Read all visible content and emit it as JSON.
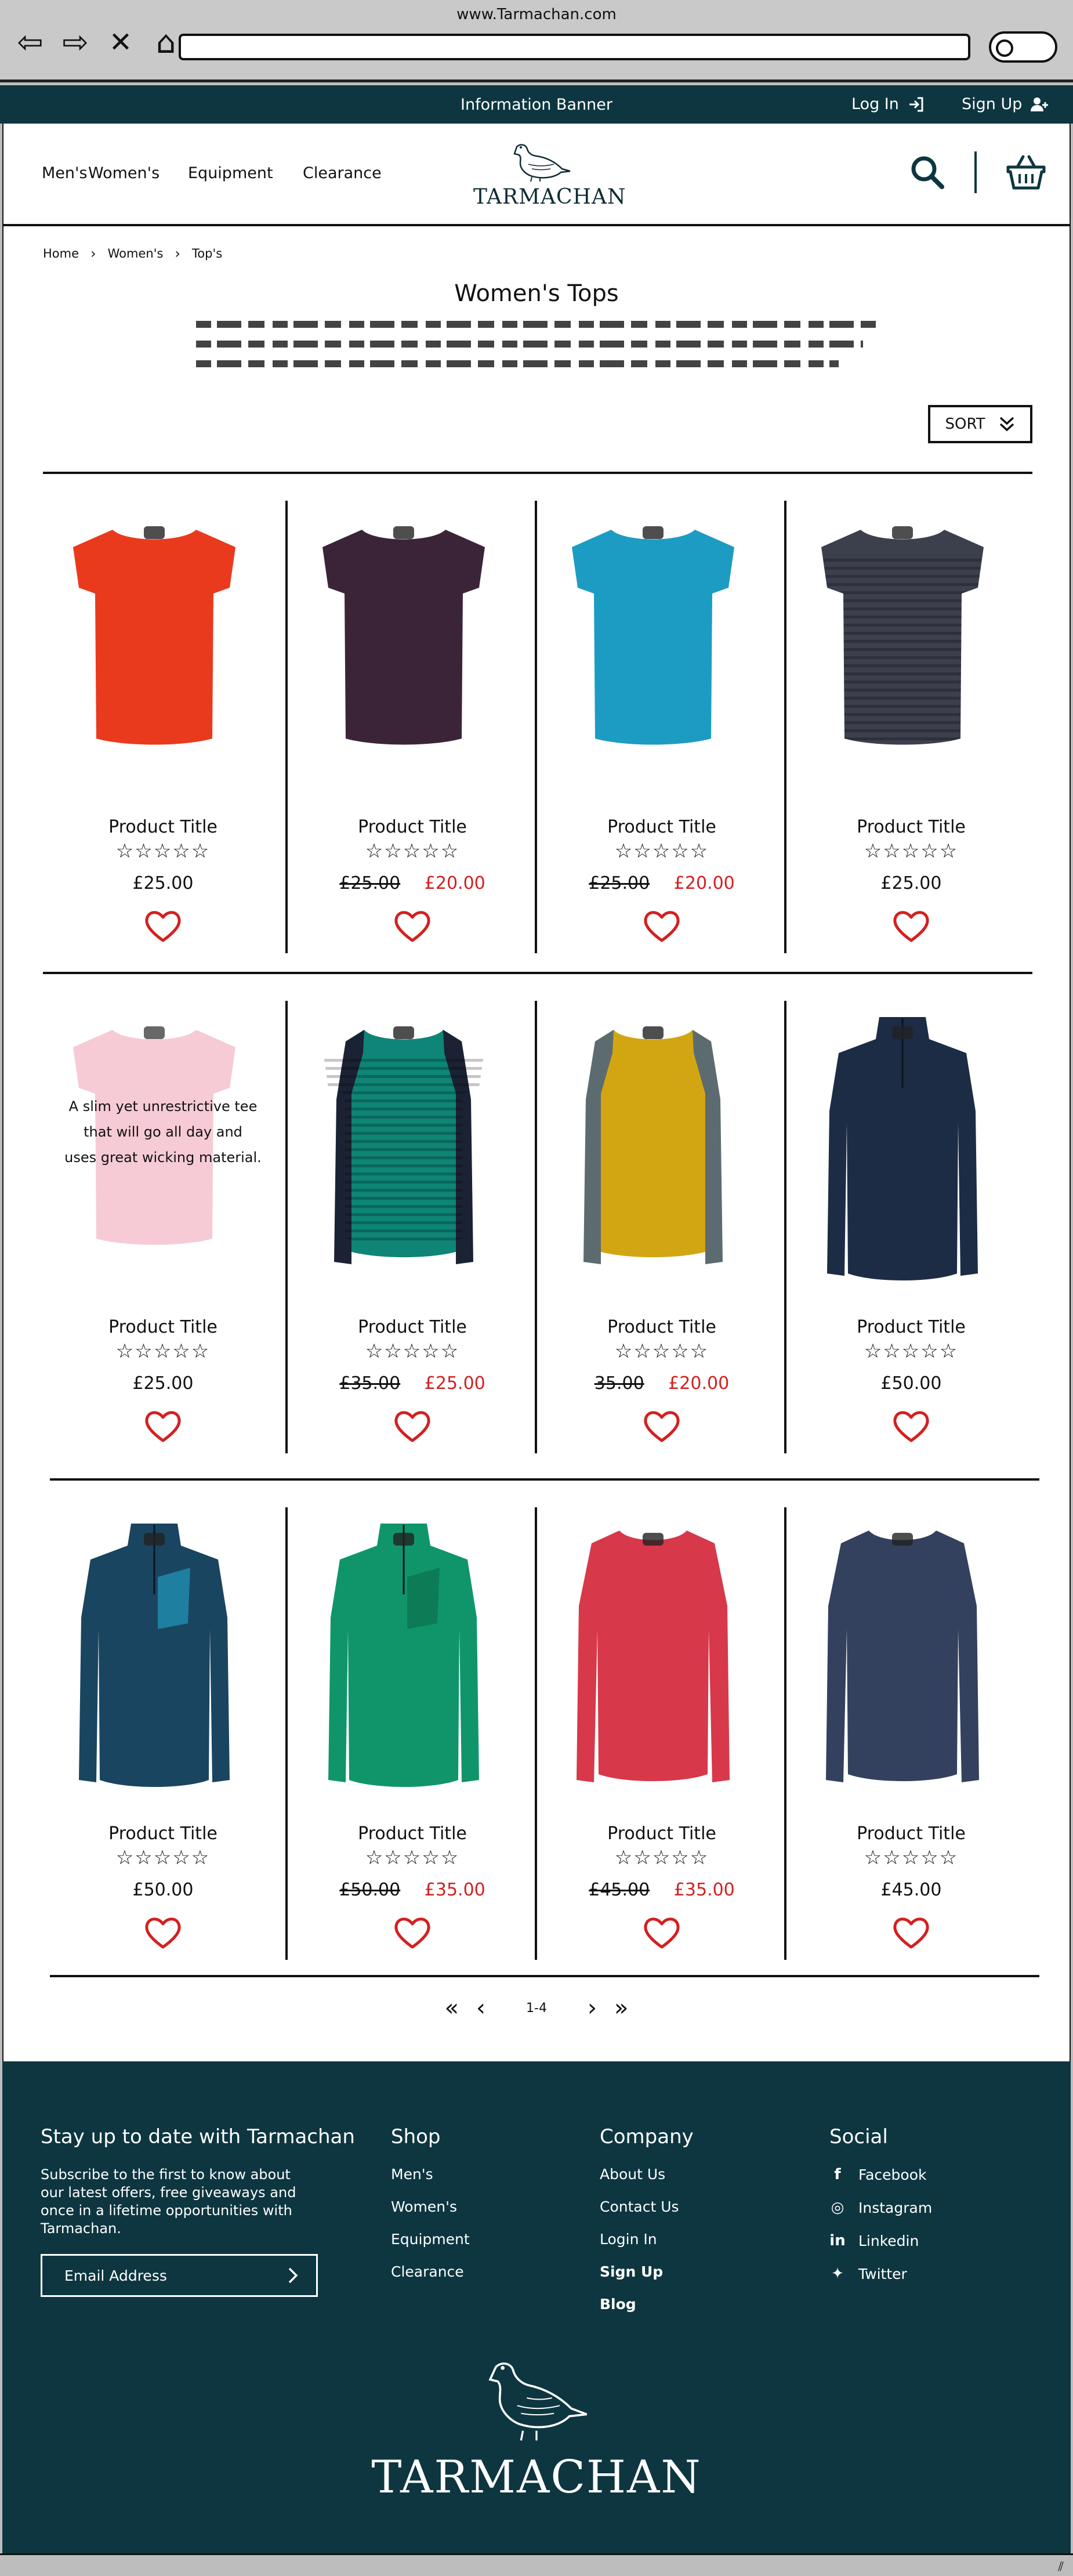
{
  "browser": {
    "url": "www.Tarmachan.com"
  },
  "banner": {
    "title": "Information Banner",
    "login": "Log In",
    "signup": "Sign Up"
  },
  "header": {
    "nav": [
      {
        "label": "Men's",
        "width": 80
      },
      {
        "label": "Women's",
        "width": 172
      },
      {
        "label": "Equipment",
        "width": 198
      },
      {
        "label": "Clearance",
        "width": 160
      }
    ],
    "logo": "TARMACHAN"
  },
  "breadcrumb": [
    "Home",
    "Women's",
    "Top's"
  ],
  "page_title": "Women's Tops",
  "sort_label": "SORT",
  "colors": {
    "accent": "#0d3640",
    "sale": "#d32020"
  },
  "products": [
    {
      "title": "Product Title",
      "price": "£25.00",
      "old_price": "",
      "color": "#ea3a1d",
      "sleeves": "short",
      "stripes": false
    },
    {
      "title": "Product Title",
      "price": "£20.00",
      "old_price": "£25.00",
      "color": "#3b2438",
      "sleeves": "short",
      "stripes": false
    },
    {
      "title": "Product Title",
      "price": "£20.00",
      "old_price": "£25.00",
      "color": "#1c9cc3",
      "sleeves": "short",
      "stripes": false
    },
    {
      "title": "Product Title",
      "price": "£25.00",
      "old_price": "",
      "color": "#3c3f4c",
      "sleeves": "short",
      "stripes": true
    },
    {
      "title": "Product Title",
      "price": "£25.00",
      "old_price": "",
      "color": "#f5c3cf",
      "sleeves": "short",
      "stripes": false,
      "overlay": "A slim yet unrestrictive tee|that will go all day and|uses great wicking material."
    },
    {
      "title": "Product Title",
      "price": "£25.00",
      "old_price": "£35.00",
      "color": "#0e8576",
      "sleeve_color": "#1b2233",
      "sleeves": "raglan",
      "stripes": true
    },
    {
      "title": "Product Title",
      "price": "£20.00",
      "old_price": "35.00",
      "color": "#d2a612",
      "sleeve_color": "#5c6b6f",
      "sleeves": "raglan",
      "stripes": false
    },
    {
      "title": "Product Title",
      "price": "£50.00",
      "old_price": "",
      "color": "#1c2c45",
      "sleeves": "zip",
      "stripes": false
    },
    {
      "title": "Product Title",
      "price": "£50.00",
      "old_price": "",
      "color": "#1a4560",
      "sleeves": "zip",
      "stripes": false,
      "pocket": "#1e7fa0"
    },
    {
      "title": "Product Title",
      "price": "£35.00",
      "old_price": "£50.00",
      "color": "#10956b",
      "sleeves": "zip",
      "stripes": false,
      "pocket": "#0d7b56"
    },
    {
      "title": "Product Title",
      "price": "£35.00",
      "old_price": "£45.00",
      "color": "#d7384a",
      "sleeves": "long",
      "stripes": false
    },
    {
      "title": "Product Title",
      "price": "£45.00",
      "old_price": "",
      "color": "#33415e",
      "sleeves": "long",
      "stripes": false
    }
  ],
  "pager": {
    "label": "1-4"
  },
  "footer": {
    "newsletter": {
      "heading": "Stay up to date with Tarmachan",
      "text": "Subscribe to the first to know about our latest offers, free giveaways and once in a lifetime opportunities with Tarmachan.",
      "placeholder": "Email Address"
    },
    "shop": {
      "heading": "Shop",
      "links": [
        "Men's",
        "Women's",
        "Equipment",
        "Clearance"
      ]
    },
    "company": {
      "heading": "Company",
      "links": [
        "About Us",
        "Contact Us",
        "Login In",
        "Sign Up",
        "Blog"
      ]
    },
    "social": {
      "heading": "Social",
      "links": [
        {
          "label": "Facebook",
          "icon": "facebook-icon"
        },
        {
          "label": "Instagram",
          "icon": "instagram-icon"
        },
        {
          "label": "Linkedin",
          "icon": "linkedin-icon"
        },
        {
          "label": "Twitter",
          "icon": "twitter-icon"
        }
      ]
    },
    "logo": "TARMACHAN"
  }
}
